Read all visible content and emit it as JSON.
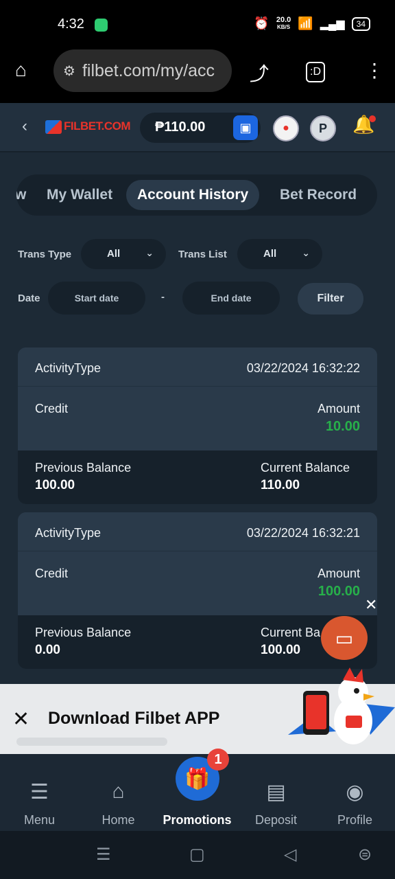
{
  "status_bar": {
    "time": "4:32",
    "net_speed": "20.0",
    "net_unit": "KB/S",
    "battery": "34"
  },
  "browser": {
    "url": "filbet.com/my/acc"
  },
  "header": {
    "logo": "FILBET.COM",
    "balance": "₱110.00",
    "level_icon": "P"
  },
  "tabs": [
    {
      "label": "w"
    },
    {
      "label": "My Wallet"
    },
    {
      "label": "Account History",
      "active": true
    },
    {
      "label": "Bet Record"
    }
  ],
  "filters": {
    "trans_type_label": "Trans Type",
    "trans_type_value": "All",
    "trans_list_label": "Trans List",
    "trans_list_value": "All",
    "date_label": "Date",
    "start_placeholder": "Start date",
    "separator": "-",
    "end_placeholder": "End date",
    "filter_button": "Filter"
  },
  "records": [
    {
      "activity_label": "ActivityType",
      "datetime": "03/22/2024 16:32:22",
      "type": "Credit",
      "amount_label": "Amount",
      "amount": "10.00",
      "prev_label": "Previous Balance",
      "prev_value": "100.00",
      "curr_label": "Current Balance",
      "curr_value": "110.00"
    },
    {
      "activity_label": "ActivityType",
      "datetime": "03/22/2024 16:32:21",
      "type": "Credit",
      "amount_label": "Amount",
      "amount": "100.00",
      "prev_label": "Previous Balance",
      "prev_value": "0.00",
      "curr_label": "Current Ba",
      "curr_value": "100.00"
    }
  ],
  "download_banner": {
    "title": "Download Filbet APP"
  },
  "bottom_nav": [
    {
      "label": "Menu",
      "icon": "menu-icon"
    },
    {
      "label": "Home",
      "icon": "home-icon"
    },
    {
      "label": "Promotions",
      "icon": "gift-icon",
      "active": true,
      "badge": "1"
    },
    {
      "label": "Deposit",
      "icon": "wallet-icon"
    },
    {
      "label": "Profile",
      "icon": "profile-icon"
    }
  ],
  "colors": {
    "accent_green": "#27b04a",
    "brand_red": "#e8332a",
    "brand_blue": "#1f6bd6"
  }
}
